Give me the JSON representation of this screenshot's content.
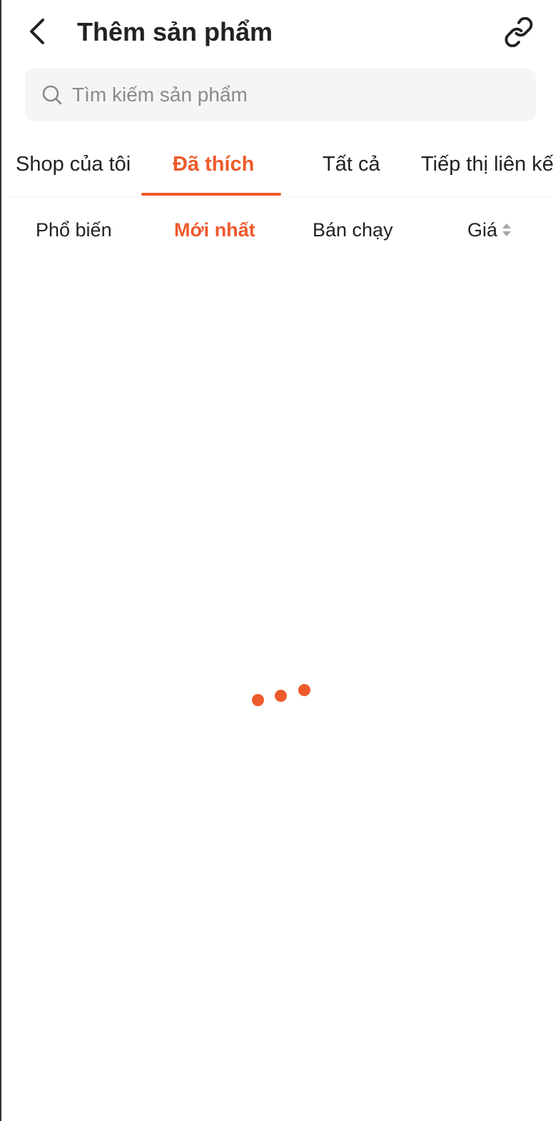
{
  "header": {
    "title": "Thêm sản phẩm",
    "back_icon": "chevron-left-icon",
    "link_icon": "link-icon"
  },
  "search": {
    "placeholder": "Tìm kiếm sản phẩm",
    "value": "",
    "icon": "search-icon"
  },
  "tabs": [
    {
      "label": "Shop của tôi",
      "active": false
    },
    {
      "label": "Đã thích",
      "active": true
    },
    {
      "label": "Tất cả",
      "active": false
    },
    {
      "label": "Tiếp thị liên kết",
      "active": false
    }
  ],
  "sort": [
    {
      "label": "Phổ biến",
      "active": false
    },
    {
      "label": "Mới nhất",
      "active": true
    },
    {
      "label": "Bán chạy",
      "active": false
    },
    {
      "label": "Giá",
      "active": false,
      "icon": "sort-arrows-icon"
    }
  ],
  "loader": {
    "icon": "loading-dots-icon",
    "color": "#ee5a2b"
  },
  "colors": {
    "accent": "#ee5a2b",
    "text": "#222222",
    "placeholder": "#8a8a8a",
    "search_bg": "#f5f5f5"
  }
}
